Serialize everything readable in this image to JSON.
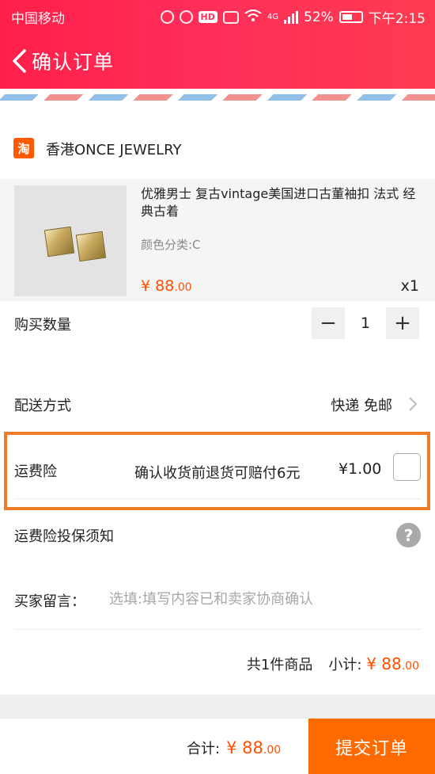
{
  "status_bar": {
    "carrier": "中国移动",
    "hd_label": "HD",
    "network": "4G",
    "battery": "52%",
    "time": "下午2:15",
    "battery_level": 0.52
  },
  "nav": {
    "title": "确认订单",
    "back_icon": "chevron-left-icon"
  },
  "shop": {
    "icon_text": "淘",
    "name": "香港ONCE JEWELRY"
  },
  "product": {
    "title": "优雅男士 复古vintage美国进口古董袖扣 法式 经典古着",
    "sku": "颜色分类:C",
    "price_symbol": "¥",
    "price_int": "88",
    "price_dec": ".00",
    "quantity": "x1"
  },
  "quantity_row": {
    "label": "购买数量",
    "minus": "−",
    "value": "1",
    "plus": "+"
  },
  "delivery": {
    "label": "配送方式",
    "value": "快递 免邮"
  },
  "insurance": {
    "label": "运费险",
    "description": "确认收货前退货可赔付6元",
    "price": "¥1.00",
    "checked": false,
    "highlight_color": "#f07c27"
  },
  "insurance_notice": {
    "label": "运费险投保须知",
    "help_icon": "?"
  },
  "message": {
    "label": "买家留言：",
    "placeholder": "选填:填写内容已和卖家协商确认"
  },
  "subtotal": {
    "count_text": "共1件商品",
    "label": "小计:",
    "symbol": "¥",
    "int": "88",
    "dec": ".00"
  },
  "footer": {
    "total_label": "合计:",
    "symbol": "¥",
    "int": "88",
    "dec": ".00",
    "submit_label": "提交订单"
  },
  "colors": {
    "header": "#ff2f5a",
    "price": "#ff5000",
    "submit": "#ff6a00"
  }
}
